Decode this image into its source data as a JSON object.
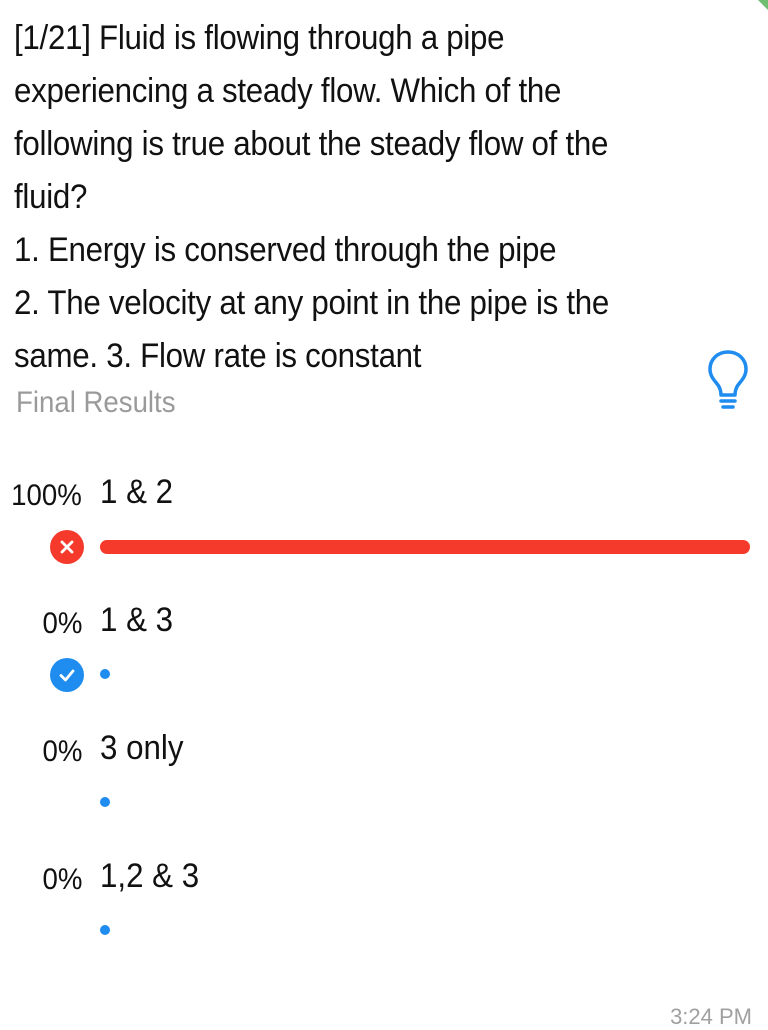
{
  "question": "[1/21] Fluid is flowing through a pipe\nexperiencing a steady flow. Which of the\nfollowing is true about the steady flow of the\nfluid?\n1. Energy is conserved through the pipe\n2. The velocity at any point in the pipe is the\nsame. 3. Flow rate is constant",
  "results_label": "Final Results",
  "hint_icon": "lightbulb-icon",
  "options": [
    {
      "percent": "100%",
      "label": "1 & 2",
      "fraction": 1.0,
      "mark": "wrong",
      "mark_icon": "cross-icon"
    },
    {
      "percent": "0%",
      "label": "1 & 3",
      "fraction": 0.0,
      "mark": "right",
      "mark_icon": "check-icon"
    },
    {
      "percent": "0%",
      "label": "3 only",
      "fraction": 0.0,
      "mark": "none",
      "mark_icon": ""
    },
    {
      "percent": "0%",
      "label": "1,2 & 3",
      "fraction": 0.0,
      "mark": "none",
      "mark_icon": ""
    }
  ],
  "colors": {
    "wrong": "#f5392b",
    "right": "#1f8cf0",
    "neutral": "#1f8cf0",
    "muted_text": "#9a9a9a",
    "hint_icon": "#1f8cf0"
  },
  "timestamp": "3:24 PM"
}
